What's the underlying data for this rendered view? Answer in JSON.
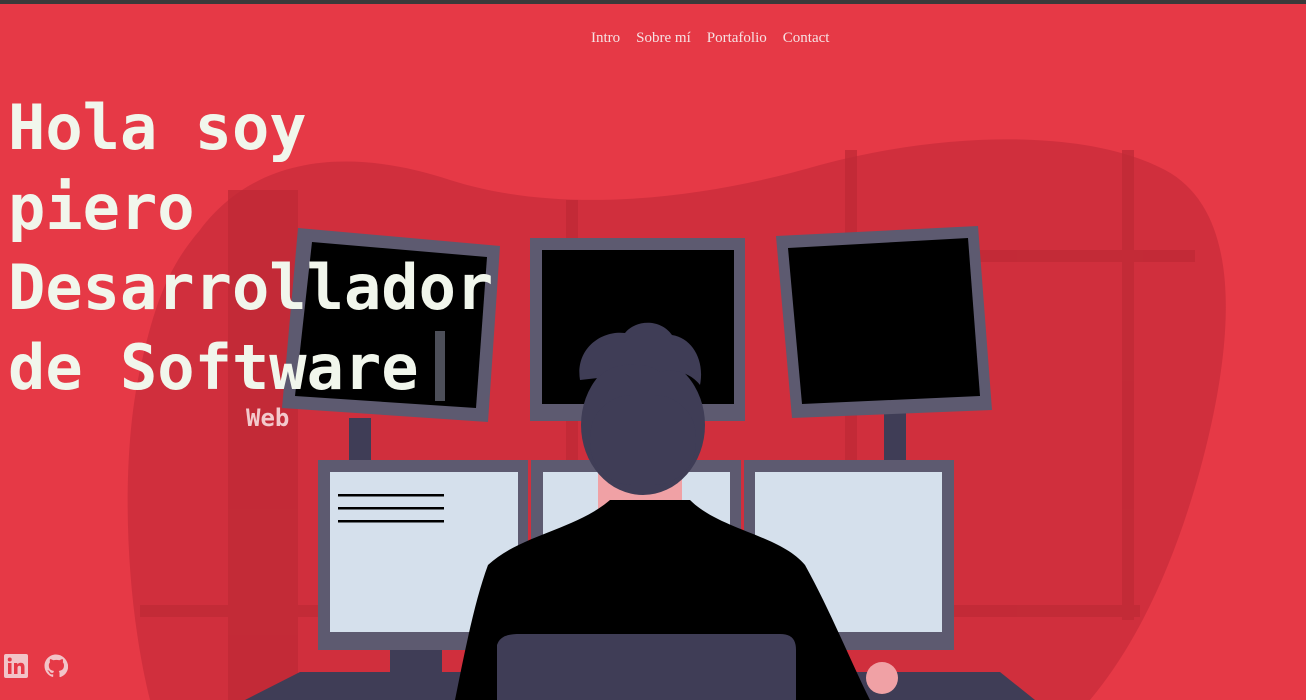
{
  "nav": {
    "items": [
      {
        "label": "Intro"
      },
      {
        "label": "Sobre mí"
      },
      {
        "label": "Portafolio"
      },
      {
        "label": "Contact"
      }
    ]
  },
  "hero": {
    "lines": [
      "Hola soy",
      "piero",
      "Desarrollador",
      "de Software"
    ],
    "subtitle": "Web"
  },
  "socials": [
    {
      "icon": "linkedin-icon"
    },
    {
      "icon": "github-icon"
    }
  ],
  "colors": {
    "background": "#e63946",
    "heading": "#f1f6ec",
    "nav_text": "#f6e2e4",
    "illustration_monitor_frame": "#5d5a70",
    "illustration_screen_dark": "#000000",
    "illustration_screen_light": "#d5e0ec"
  }
}
